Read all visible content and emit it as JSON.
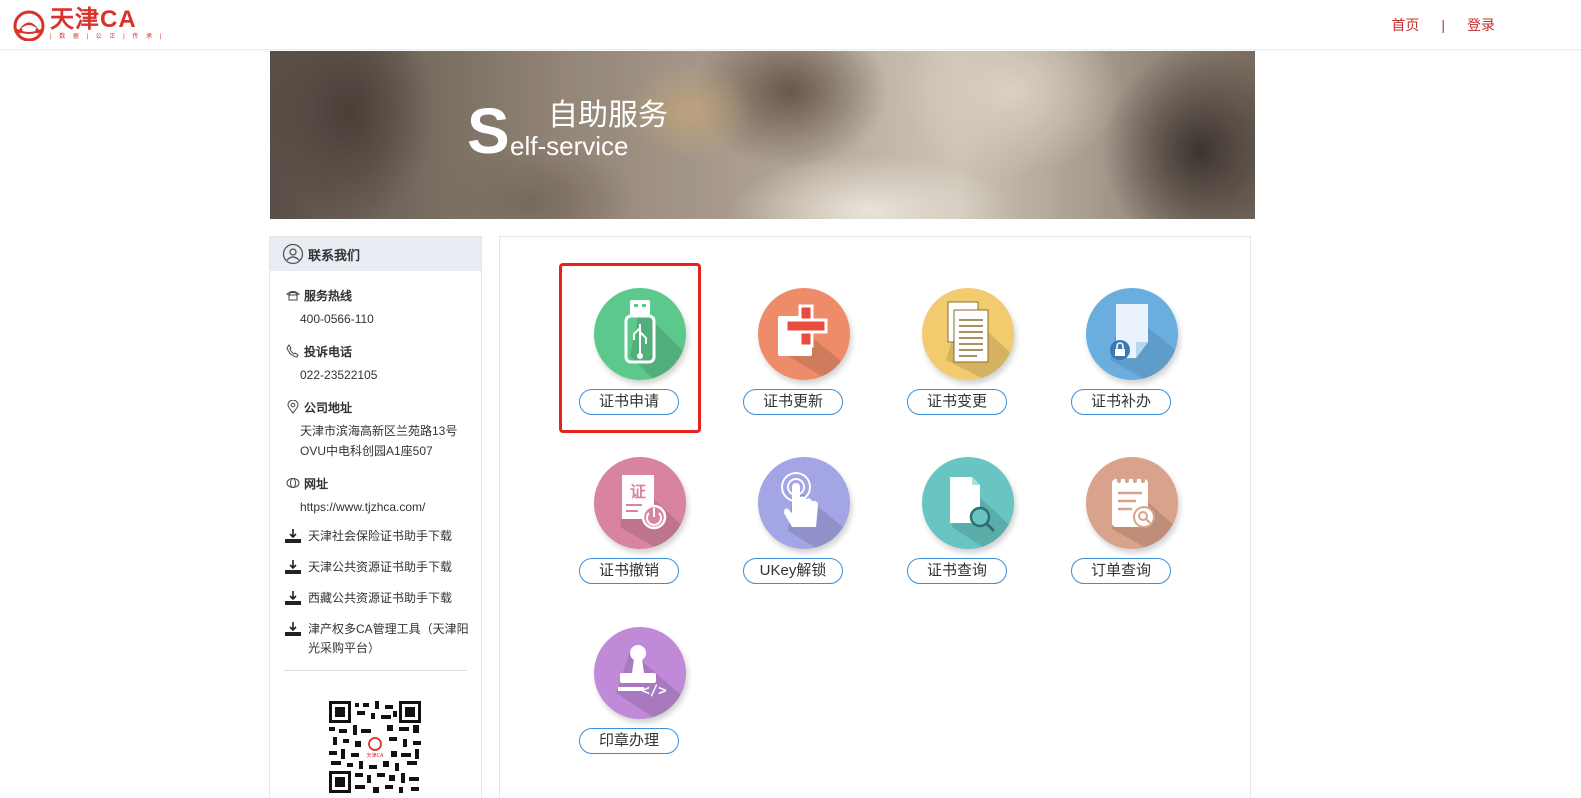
{
  "header": {
    "logo_title": "天津CA",
    "logo_sub": "| 数 据 | 公 正 | 传 承 |",
    "nav": [
      {
        "label": "首页"
      },
      {
        "label": "登录"
      }
    ],
    "nav_separator": "|"
  },
  "banner": {
    "cn_title": "自助服务",
    "en_big": "S",
    "en_rest": "elf-service"
  },
  "sidebar": {
    "title": "联系我们",
    "hotline": {
      "label": "服务热线",
      "value": "400-0566-110"
    },
    "complaint": {
      "label": "投诉电话",
      "value": "022-23522105"
    },
    "address": {
      "label": "公司地址",
      "line1": "天津市滨海高新区兰苑路13号",
      "line2": "OVU中电科创园A1座507"
    },
    "website": {
      "label": "网址",
      "value": "https://www.tjzhca.com/"
    },
    "downloads": [
      {
        "label": "天津社会保险证书助手下载"
      },
      {
        "label": "天津公共资源证书助手下载"
      },
      {
        "label": "西藏公共资源证书助手下载"
      },
      {
        "label": "津产权多CA管理工具（天津阳光采购平台）"
      }
    ],
    "qr_logo_text": "天津CA"
  },
  "services": [
    {
      "label": "证书申请",
      "color": "#5dc88c",
      "icon": "usb-icon"
    },
    {
      "label": "证书更新",
      "color": "#ee8c6a",
      "icon": "medical-cross-icon"
    },
    {
      "label": "证书变更",
      "color": "#f2cb6f",
      "icon": "documents-icon"
    },
    {
      "label": "证书补办",
      "color": "#6aaee0",
      "icon": "locked-document-icon"
    },
    {
      "label": "证书撤销",
      "color": "#d9849f",
      "icon": "certificate-power-icon"
    },
    {
      "label": "UKey解锁",
      "color": "#a3a5e4",
      "icon": "finger-touch-icon"
    },
    {
      "label": "证书查询",
      "color": "#68c5c2",
      "icon": "document-search-icon"
    },
    {
      "label": "订单查询",
      "color": "#d9a28a",
      "icon": "clipboard-search-icon"
    },
    {
      "label": "印章办理",
      "color": "#c08ad9",
      "icon": "stamp-code-icon"
    }
  ]
}
